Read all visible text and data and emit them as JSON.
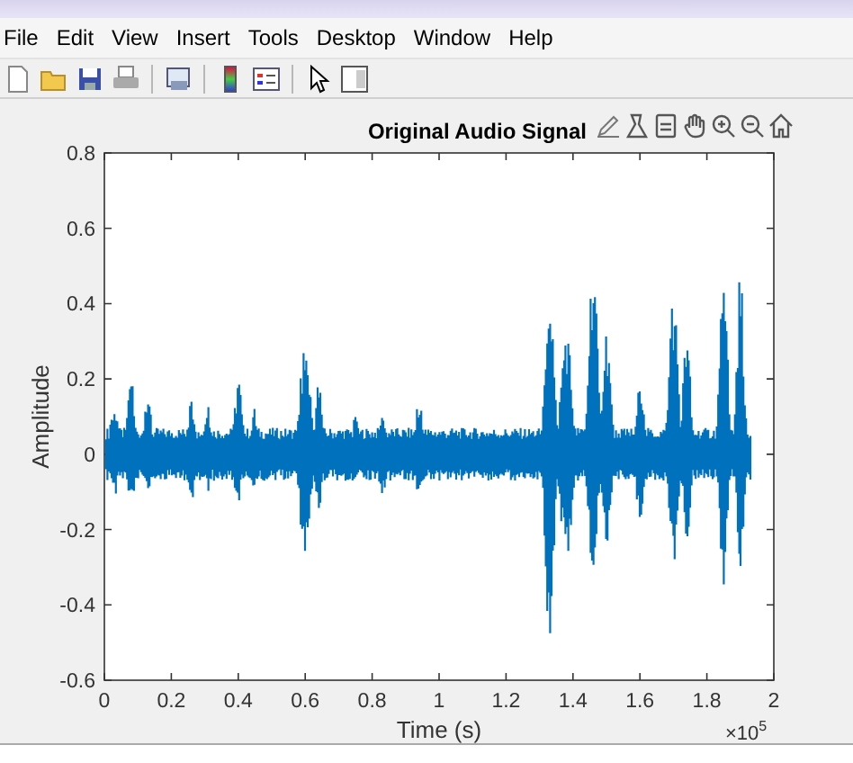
{
  "menu": [
    "File",
    "Edit",
    "View",
    "Insert",
    "Tools",
    "Desktop",
    "Window",
    "Help"
  ],
  "plot": {
    "title": "Original Audio Signal",
    "xlabel": "Time (s)",
    "ylabel": "Amplitude",
    "xticks": [
      "0",
      "0.2",
      "0.4",
      "0.6",
      "0.8",
      "1",
      "1.2",
      "1.4",
      "1.6",
      "1.8",
      "2"
    ],
    "yticks": [
      "0.8",
      "0.6",
      "0.4",
      "0.2",
      "0",
      "-0.2",
      "-0.4",
      "-0.6"
    ],
    "exponent_base": "×10",
    "exponent": "5"
  }
}
